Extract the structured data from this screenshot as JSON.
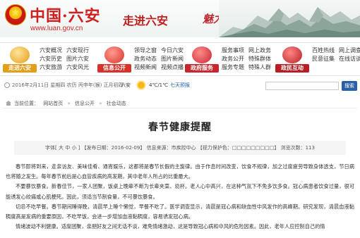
{
  "header": {
    "site_name": "中国·六安",
    "url": "www.luan.gov.cn",
    "slogan_1": "走进六安",
    "slogan_2": "魅力六安",
    "colors": {
      "brand_red": "#d01f1f",
      "nav_blue": "#2a5fa5"
    }
  },
  "nav": [
    {
      "badge": "走进六安",
      "color": "#e39e1a",
      "icon": "landscape-icon",
      "links": [
        "六安概况",
        "六安现行",
        "六安历史",
        "图片六安",
        "六安旅游",
        "六安风光"
      ]
    },
    {
      "badge": "信息公开",
      "color": "#d6342b",
      "icon": "info-icon",
      "links": [
        "领导之窗",
        "今日六安",
        "政务动态",
        "图片新闻",
        "视频新闻",
        "视频点播"
      ]
    },
    {
      "badge": "政府服务",
      "color": "#c7262d",
      "icon": "service-icon",
      "links": [
        "服务事项",
        "网上政务",
        "政务公开",
        "特殊群体",
        "服务专题",
        "特殊人群"
      ]
    },
    {
      "badge": "政民互动",
      "color": "#b62025",
      "icon": "interaction-icon",
      "links": [
        "百姓热线",
        "网上调查",
        "民意征集",
        "在线访谈"
      ]
    }
  ],
  "datebar": {
    "date": "2016年2月11日 星期四 农历 丙申年(猴) 正月初四",
    "weather_location": "六安",
    "weather_icon": "sun-icon",
    "temperature": "4℃/1℃",
    "forecast_link": "七天预报"
  },
  "search": {
    "placeholder": "",
    "button": "搜索"
  },
  "breadcrumb": {
    "label": "当前位置：",
    "items": [
      "网站首页",
      "信息公开",
      "社会动态"
    ],
    "separator": "»"
  },
  "article": {
    "title": "春节健康提醒",
    "meta_font_size": "字体[ 大 中 小 ]",
    "meta_date": "【发布日期：2016-02-09】",
    "meta_source": "信息来源：市疾控中心",
    "meta_protect": "【视力保护色：",
    "meta_protect_boxes": "□□□□□□□□□",
    "meta_protect_end": "】",
    "meta_views": "浏览次数：113",
    "paragraphs": [
      "春节即将到来，走亲访友、美味佳肴、通宵娱乐，这都将是春节长假的主旋律。由于作息时间改变，饮食不规律，加之过度疲劳导致身体透支，节日病也将随之发生。每年春节前后是心血管疾病的高发期，其中老年人所占的比重最大。",
      "不要暴饮暴食。新春佳节，一家人团聚，饭桌上晚辈不断为长辈夹菜、劝杯。老人心中高兴，在这种气氛下不免多饮多食。冠心病患者饮食过量，很可能诱发心绞痛或心肌梗死。因此，须适当节制食量，不可暴饮暴食。",
      "切忌不吃早餐。春节期间睡得晚，清晨早上睡个懒觉，早餐不吃了。医学调查显示，清晨是冠心病和缺血性中风发作的高峰期。研究发现，清晨血液黏稠度高是发病的重要原因，不吃早饭，会进一步增加血液黏稠度，容易诱发冠心病。",
      "情绪波动不利健康。适度团聚，亲朋好友之间无话不谈，难免情绪激动，这是导致冠心病和中风的危险因素。因此，老年人应控制自己的情"
    ]
  }
}
